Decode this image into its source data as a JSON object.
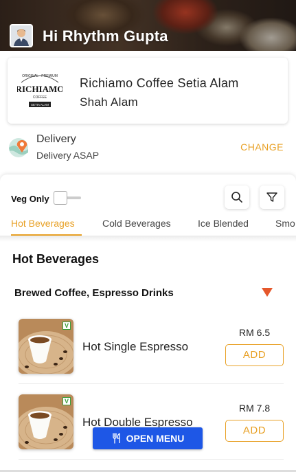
{
  "header": {
    "greeting": "Hi Rhythm Gupta",
    "avatar_icon": "user-avatar-icon"
  },
  "store": {
    "name": "Richiamo Coffee Setia Alam",
    "area": "Shah Alam",
    "logo": {
      "wordmark": "RICHIAMO",
      "top_text": "ORIGINAL · PREMIUM",
      "sub_text": "COFFEE",
      "bottom_text": "SETIA ALAM"
    }
  },
  "delivery": {
    "title": "Delivery",
    "subtitle": "Delivery ASAP",
    "change_label": "CHANGE",
    "icon": "location-pin-icon"
  },
  "filters": {
    "veg_only_label": "Veg Only",
    "veg_only_on": false
  },
  "tabs": [
    {
      "label": "Hot Beverages",
      "active": true
    },
    {
      "label": "Cold Beverages",
      "active": false
    },
    {
      "label": "Ice Blended",
      "active": false
    },
    {
      "label": "Smo",
      "active": false
    }
  ],
  "menu": {
    "section_title": "Hot Beverages",
    "subsection_title": "Brewed Coffee, Espresso Drinks",
    "items": [
      {
        "name": "Hot Single Espresso",
        "price": "RM 6.5",
        "add_label": "ADD",
        "veg_badge": "V"
      },
      {
        "name": "Hot Double Espresso",
        "price": "RM 7.8",
        "add_label": "ADD",
        "veg_badge": "V"
      }
    ]
  },
  "open_menu_label": "OPEN MENU",
  "colors": {
    "accent": "#e8a024",
    "arrow": "#e5572b",
    "open_menu_bg": "#1e57e6",
    "veg_green": "#3a9d3a"
  }
}
